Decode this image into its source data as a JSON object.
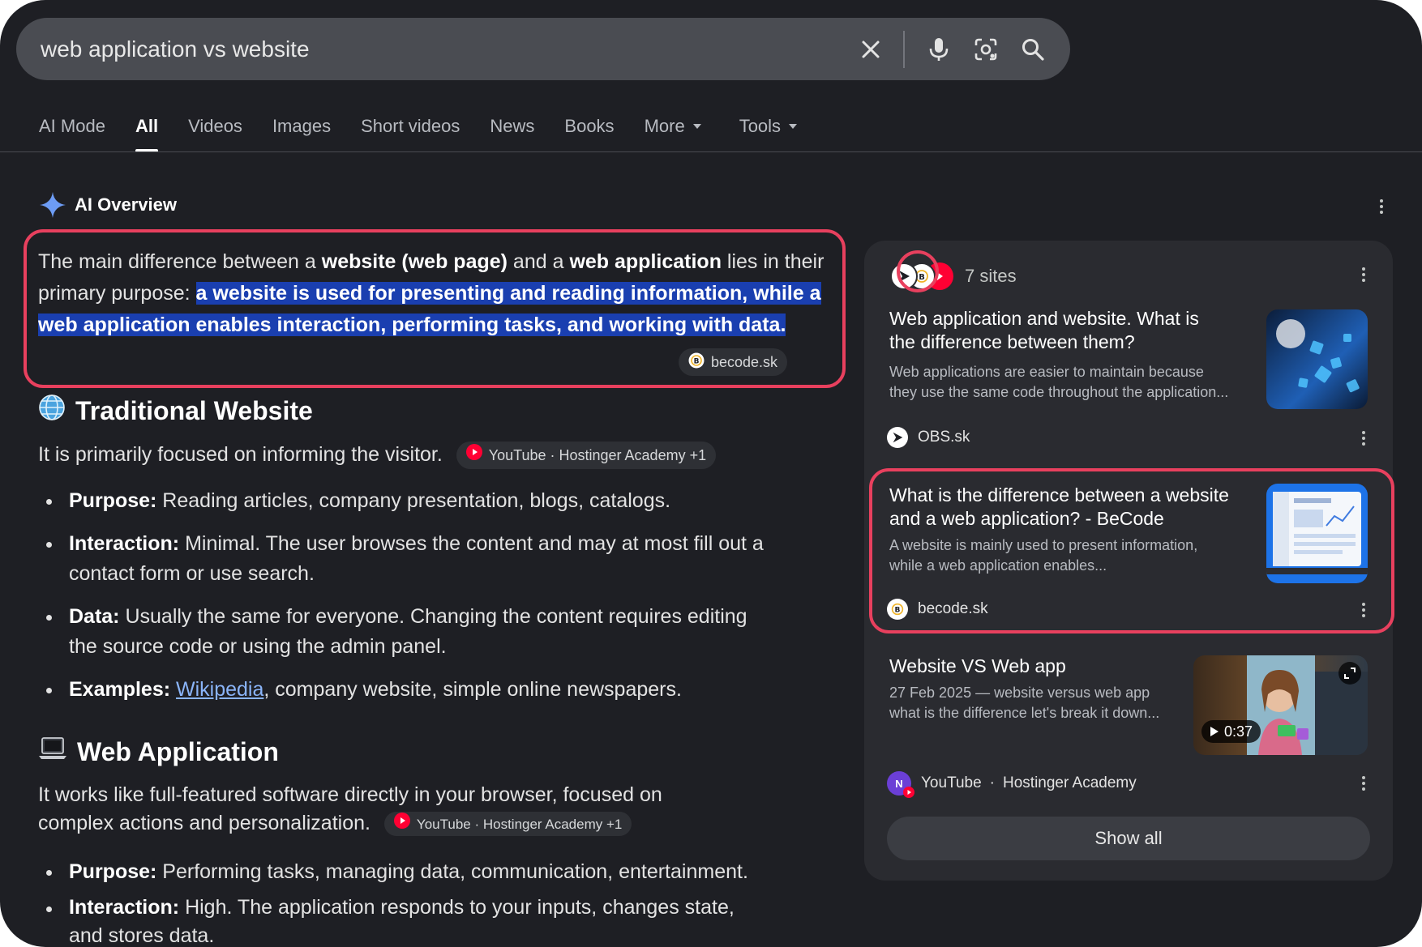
{
  "search": {
    "query": "web application vs website"
  },
  "tabs": [
    {
      "label": "AI Mode"
    },
    {
      "label": "All",
      "active": true
    },
    {
      "label": "Videos"
    },
    {
      "label": "Images"
    },
    {
      "label": "Short videos"
    },
    {
      "label": "News"
    },
    {
      "label": "Books"
    },
    {
      "label": "More",
      "dropdown": true
    },
    {
      "label": "Tools",
      "dropdown": true
    }
  ],
  "ai_overview": {
    "title": "AI Overview",
    "intro": {
      "t1": "The main difference between a ",
      "b1": "website (web page)",
      "t2": " and a ",
      "b2": "web application",
      "t3": " lies in their primary purpose: ",
      "highlight": "a website is used for presenting and reading information, while a web application enables interaction, performing tasks, and working with data."
    },
    "intro_source": "becode.sk",
    "section1": {
      "heading": "Traditional Website",
      "lead": "It is primarily focused on informing the visitor.",
      "chip": "YouTube · Hostinger Academy +1",
      "bullets": [
        {
          "label": "Purpose:",
          "text": " Reading articles, company presentation, blogs, catalogs."
        },
        {
          "label": "Interaction:",
          "text": " Minimal. The user browses the content and may at most fill out a contact form or use search."
        },
        {
          "label": "Data:",
          "text": " Usually the same for everyone. Changing the content requires editing the source code or using the admin panel."
        }
      ],
      "examples_label": "Examples:",
      "examples_link": "Wikipedia",
      "examples_rest": ", company website, simple online newspapers."
    },
    "section2": {
      "heading": "Web Application",
      "lead1": "It works like full-featured software directly in your browser, focused on",
      "lead2": "complex actions and personalization.",
      "chip": "YouTube · Hostinger Academy +1",
      "bullets": [
        {
          "label": "Purpose:",
          "text": " Performing tasks, managing data, communication, entertainment."
        },
        {
          "label": "Interaction:",
          "text": " High. The application responds to your inputs, changes state, and stores data."
        }
      ]
    }
  },
  "panel": {
    "sites_label": "7 sites",
    "cards": [
      {
        "title1": "Web application and website. What is",
        "title2": "the difference between them?",
        "snip1": "Web applications are easier to maintain because",
        "snip2": "they use the same code throughout the application...",
        "source": "OBS.sk"
      },
      {
        "title1": "What is the difference between a website",
        "title2": "and a web application? - BeCode",
        "snip1": "A website is mainly used to present information,",
        "snip2": "while a web application enables...",
        "source": "becode.sk"
      },
      {
        "title1": "Website VS Web app",
        "snip1": "27 Feb 2025 — website versus web app",
        "snip2": "what is the difference let's break it down...",
        "source": "YouTube",
        "source_sep": "·",
        "source_sub": "Hostinger Academy",
        "duration": "0:37"
      }
    ],
    "show_all": "Show all"
  },
  "colors": {
    "background": "#1e1f24",
    "highlight": "#1a3fb0",
    "annotation": "#e8405e",
    "link": "#8ab4f8"
  }
}
